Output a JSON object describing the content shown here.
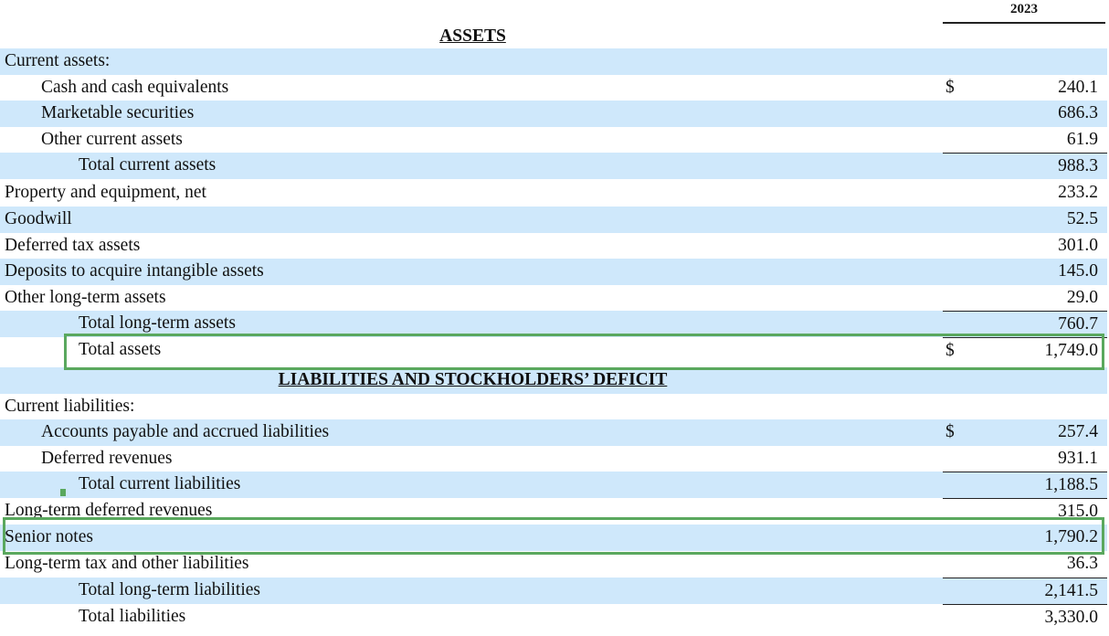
{
  "column_header": "2023",
  "rows": [
    {
      "label": "ASSETS",
      "type": "heading"
    },
    {
      "label": "Current assets:",
      "indent": 0
    },
    {
      "label": "Cash and cash equivalents",
      "indent": 1,
      "dollar": "$",
      "value": "240.1"
    },
    {
      "label": "Marketable securities",
      "indent": 1,
      "value": "686.3"
    },
    {
      "label": "Other current assets",
      "indent": 1,
      "value": "61.9"
    },
    {
      "label": "Total current assets",
      "indent": 2,
      "value": "988.3"
    },
    {
      "label": "Property and equipment, net",
      "indent": 0,
      "value": "233.2"
    },
    {
      "label": "Goodwill",
      "indent": 0,
      "value": "52.5"
    },
    {
      "label": "Deferred tax assets",
      "indent": 0,
      "value": "301.0"
    },
    {
      "label": "Deposits to acquire intangible assets",
      "indent": 0,
      "value": "145.0"
    },
    {
      "label": "Other long-term assets",
      "indent": 0,
      "value": "29.0"
    },
    {
      "label": "Total long-term assets",
      "indent": 2,
      "value": "760.7"
    },
    {
      "label": "Total assets",
      "indent": 2,
      "dollar": "$",
      "value": "1,749.0"
    },
    {
      "label": "LIABILITIES AND STOCKHOLDERS’ DEFICIT",
      "type": "heading"
    },
    {
      "label": "Current liabilities:",
      "indent": 0
    },
    {
      "label": "Accounts payable and accrued liabilities",
      "indent": 1,
      "dollar": "$",
      "value": "257.4"
    },
    {
      "label": "Deferred revenues",
      "indent": 1,
      "value": "931.1"
    },
    {
      "label": "Total current liabilities",
      "indent": 2,
      "value": "1,188.5"
    },
    {
      "label": "Long-term deferred revenues",
      "indent": 0,
      "value": "315.0"
    },
    {
      "label": "Senior notes",
      "indent": 0,
      "value": "1,790.2"
    },
    {
      "label": "Long-term tax and other liabilities",
      "indent": 0,
      "value": "36.3"
    },
    {
      "label": "Total long-term liabilities",
      "indent": 2,
      "value": "2,141.5"
    },
    {
      "label": "Total liabilities",
      "indent": 2,
      "value": "3,330.0"
    }
  ]
}
